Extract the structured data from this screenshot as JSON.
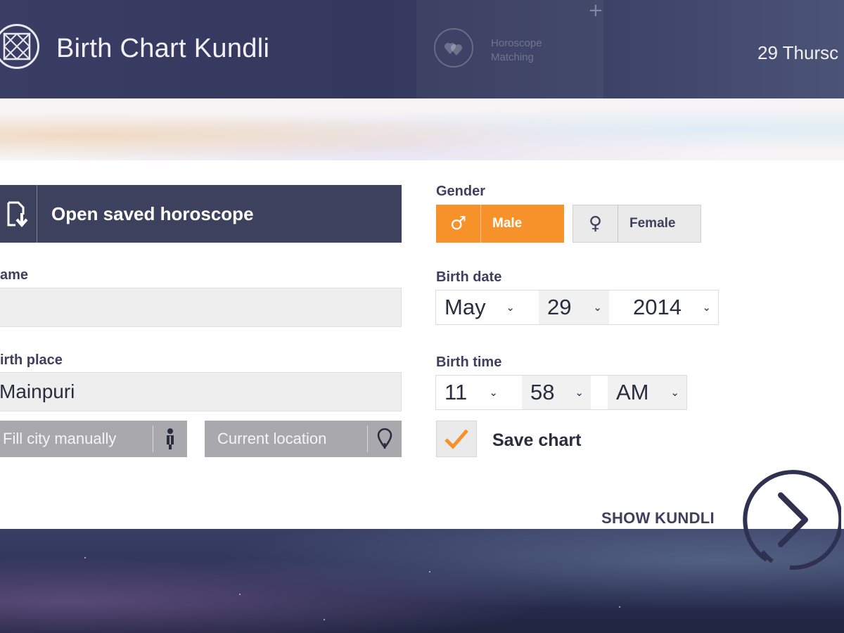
{
  "header": {
    "title": "Birth Chart Kundli",
    "matching_label": "Horoscope Matching",
    "date": "29 Thursc"
  },
  "form": {
    "open_saved": "Open saved horoscope",
    "name_label": "ame",
    "name_value": "",
    "birthplace_label": "irth place",
    "birthplace_value": "Mainpuri",
    "fill_city": "Fill city manually",
    "current_location": "Current location",
    "gender_label": "Gender",
    "male": "Male",
    "female": "Female",
    "male_symbol": "♂",
    "female_symbol": "♀",
    "birthdate_label": "Birth date",
    "month": "May",
    "day": "29",
    "year": "2014",
    "birthtime_label": "Birth time",
    "hour": "11",
    "minute": "58",
    "ampm": "AM",
    "save_chart": "Save chart",
    "save_checked": true,
    "show_kundli": "SHOW KUNDLI"
  },
  "icons": {
    "logo": "kundli-grid-icon",
    "matching": "hearts-icon",
    "add": "plus-icon",
    "open": "document-download-icon",
    "fill_city": "person-pin-icon",
    "location": "location-pin-icon",
    "chevron": "chevron-down-icon",
    "check": "checkmark-icon",
    "next": "arrow-right-circle-icon"
  },
  "colors": {
    "accent": "#f7922b",
    "primary": "#3d415e",
    "field_bg": "#efeeef"
  }
}
